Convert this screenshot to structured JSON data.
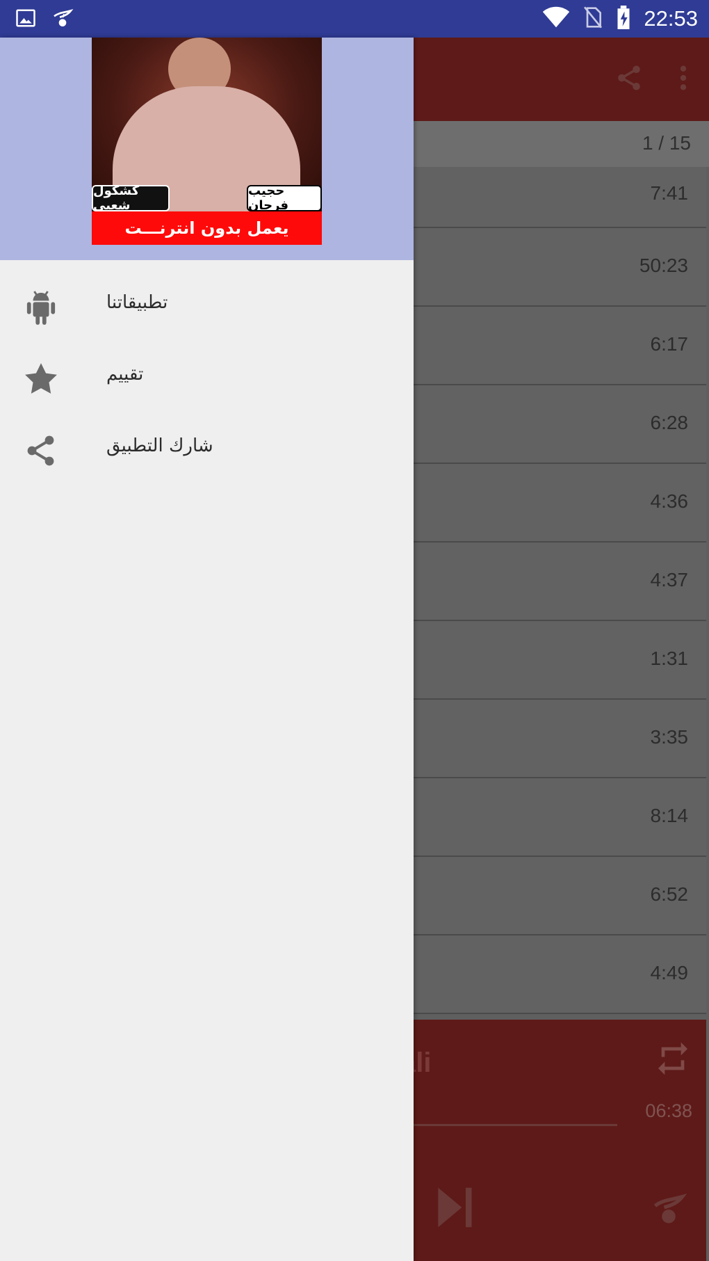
{
  "status_bar": {
    "time": "22:53",
    "icons": [
      "gallery-icon",
      "leaf-icon",
      "wifi-icon",
      "no-sim-icon",
      "battery-charging-icon"
    ]
  },
  "background_app": {
    "toolbar_icons": [
      "share-icon",
      "more-vert-icon"
    ],
    "counter": "1 / 15",
    "tracks": [
      {
        "duration": "7:41"
      },
      {
        "duration": "50:23"
      },
      {
        "duration": "6:17"
      },
      {
        "duration": "6:28"
      },
      {
        "duration": "4:36"
      },
      {
        "duration": "4:37"
      },
      {
        "duration": "1:31"
      },
      {
        "duration": "3:35"
      },
      {
        "duration": "8:14"
      },
      {
        "duration": "6:52"
      },
      {
        "duration": "4:49"
      }
    ],
    "player": {
      "title_partial": "ali",
      "total_time": "06:38"
    }
  },
  "drawer": {
    "cover": {
      "label_left": "كشكول شعبي",
      "label_right": "حجيب فرحان",
      "banner": "يعمل بدون انترنـــت"
    },
    "menu": [
      {
        "label": "تطبيقاتنا",
        "icon": "android-icon"
      },
      {
        "label": "تقييم",
        "icon": "star-icon"
      },
      {
        "label": "شارك التطبيق",
        "icon": "share-icon"
      }
    ]
  },
  "colors": {
    "status_bar": "#2f3b94",
    "drawer_header": "#aeb5e0",
    "drawer_bg": "#efefef",
    "toolbar": "#5e1a18",
    "banner_red": "#ff0a0a"
  }
}
